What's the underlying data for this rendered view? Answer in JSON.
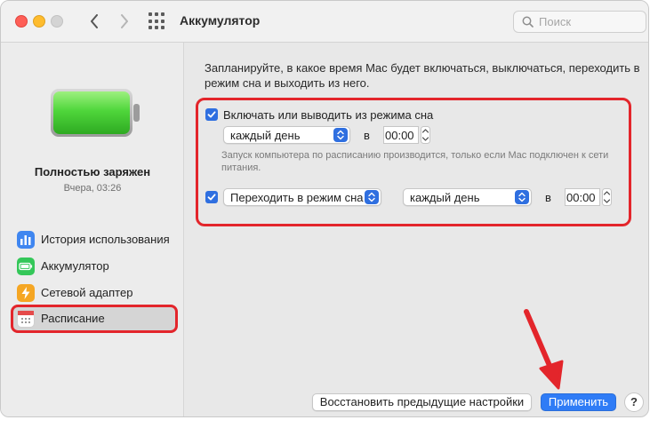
{
  "window": {
    "title": "Аккумулятор"
  },
  "search": {
    "placeholder": "Поиск"
  },
  "sidebar": {
    "battery_status": "Полностью заряжен",
    "battery_time": "Вчера, 03:26",
    "items": [
      {
        "label": "История использования",
        "icon": "bar-chart-icon"
      },
      {
        "label": "Аккумулятор",
        "icon": "battery-icon"
      },
      {
        "label": "Сетевой адаптер",
        "icon": "lightning-icon"
      },
      {
        "label": "Расписание",
        "icon": "calendar-icon",
        "selected": true
      }
    ]
  },
  "main": {
    "description": "Запланируйте, в какое время Mac будет включаться, выключаться, переходить в режим сна и выходить из него.",
    "row1": {
      "checked": true,
      "label": "Включать или выводить из режима сна",
      "day": "каждый день",
      "at": "в",
      "time": "00:00"
    },
    "note": "Запуск компьютера по расписанию производится, только если Mac подключен к сети питания.",
    "row2": {
      "checked": true,
      "action": "Переходить в режим сна",
      "day": "каждый день",
      "at": "в",
      "time": "00:00"
    },
    "buttons": {
      "restore": "Восстановить предыдущие настройки",
      "apply": "Применить",
      "help": "?"
    }
  },
  "colors": {
    "accent": "#2f6fe0",
    "highlight": "#e3252b",
    "battery_fill": "#48d13a"
  }
}
